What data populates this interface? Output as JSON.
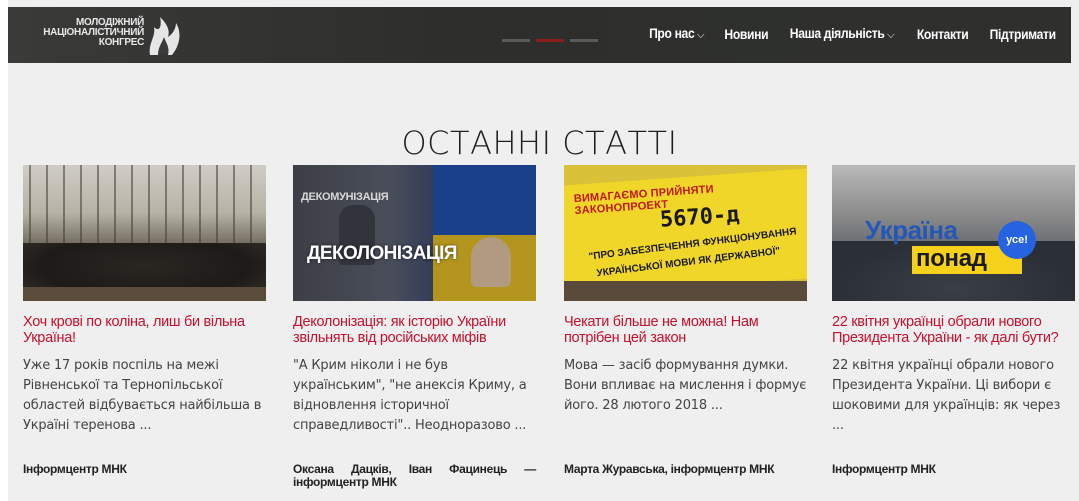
{
  "header": {
    "logo": {
      "line1": "МОЛОДІЖНИЙ",
      "line2": "НАЦІОНАЛІСТИЧНИЙ",
      "line3": "КОНГРЕС"
    },
    "nav": [
      {
        "label": "Про нас",
        "has_dropdown": true
      },
      {
        "label": "Новини",
        "has_dropdown": false
      },
      {
        "label": "Наша діяльність",
        "has_dropdown": true
      },
      {
        "label": "Контакти",
        "has_dropdown": false
      },
      {
        "label": "Підтримати",
        "has_dropdown": false
      }
    ],
    "chevron": "⌵",
    "slider_active_index": 1,
    "slider_count": 3
  },
  "section": {
    "title": "ОСТАННІ СТАТТІ"
  },
  "articles": [
    {
      "title": "Хоч крові по коліна, лиш би вільна Україна!",
      "excerpt": "Уже 17 років поспіль на межі Рівненської та Тернопільської областей відбувається найбільша в Україні теренова ...",
      "author": "Інформцентр МНК",
      "image_icon": "forest-group-photo"
    },
    {
      "title": "Деколонізація: як історію України звільнять від російських міфів",
      "excerpt": "\"А Крим ніколи і не був українським\", \"не анексія Криму, а відновлення історичної справедливості\".. Неодноразово ...",
      "author": "Оксана Дацків, Іван Фацинець — інформцентр МНК",
      "image_icon": "decolonization-collage",
      "image_text_small": "ДЕКОМУНІЗАЦІЯ",
      "image_text_large": "ДЕКОЛОНІЗАЦІЯ"
    },
    {
      "title": "Чекати більше не можна! Нам потрібен цей закон",
      "excerpt": "Мова — засіб формування думки. Вони впливає на мислення і формує його. 28 лютого 2018 ...",
      "author": "Марта Журавська, інформцентр МНК",
      "image_icon": "protest-banner",
      "image_text_top": "ВИМАГАЄМО ПРИЙНЯТИ ЗАКОНОПРОЕКТ",
      "image_text_number": "5670-д",
      "image_text_line2": "\"ПРО ЗАБЕЗПЕЧЕННЯ ФУНКЦІОНУВАННЯ",
      "image_text_line3": "УКРАЇНСЬКОЇ МОВИ ЯК ДЕРЖАВНОЇ\""
    },
    {
      "title": "22 квітня українці обрали нового Президента України - як далі бути?",
      "excerpt": "22 квітня українці обрали нового Президента України. Ці вибори є шоковими для українців: як через ...",
      "author": "Інформцентр МНК",
      "image_icon": "crowd-ukraine-banner",
      "image_text_word1": "Україна",
      "image_text_word2": "понад",
      "image_text_badge": "усе!"
    }
  ],
  "colors": {
    "header_bg": "#2f302e",
    "page_bg": "#efefef",
    "title_red": "#c8102e",
    "slider_active": "#8b1d1d"
  }
}
